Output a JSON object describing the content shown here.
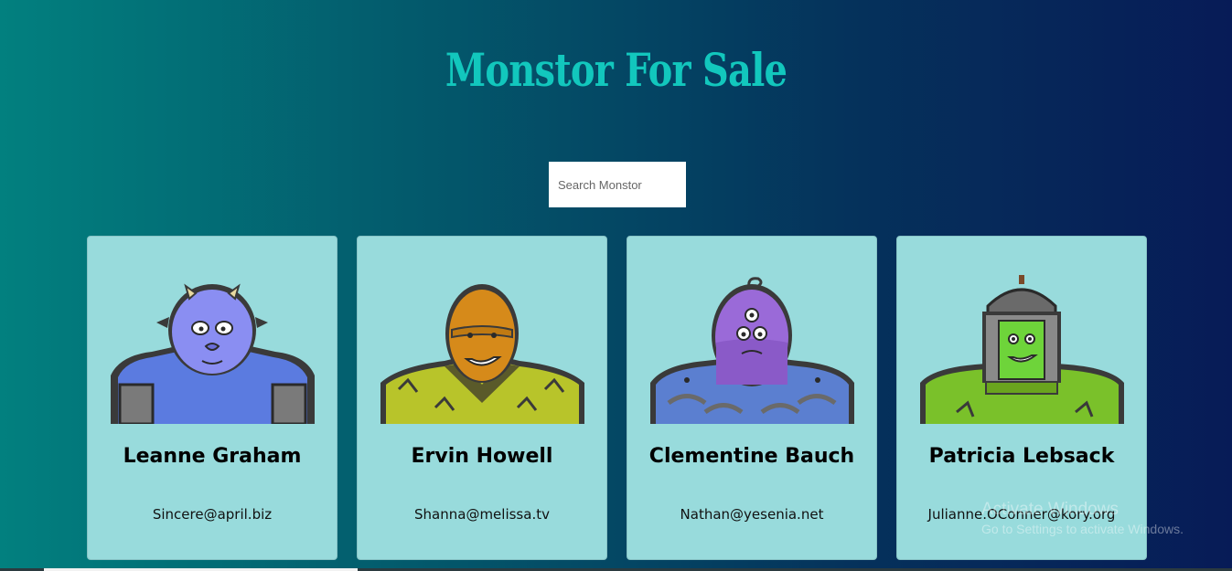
{
  "header": {
    "title": "Monstor For Sale"
  },
  "search": {
    "placeholder": "Search Monstor"
  },
  "monsters": [
    {
      "name": "Leanne Graham",
      "email": "Sincere@april.biz"
    },
    {
      "name": "Ervin Howell",
      "email": "Shanna@melissa.tv"
    },
    {
      "name": "Clementine Bauch",
      "email": "Nathan@yesenia.net"
    },
    {
      "name": "Patricia Lebsack",
      "email": "Julianne.OConner@kory.org"
    }
  ],
  "watermark": {
    "line1": "Activate Windows",
    "line2": "Go to Settings to activate Windows."
  },
  "colors": {
    "title": "#12c7bd",
    "card": "#98dbdc",
    "background_start": "#02807f",
    "background_end": "#071b57"
  }
}
